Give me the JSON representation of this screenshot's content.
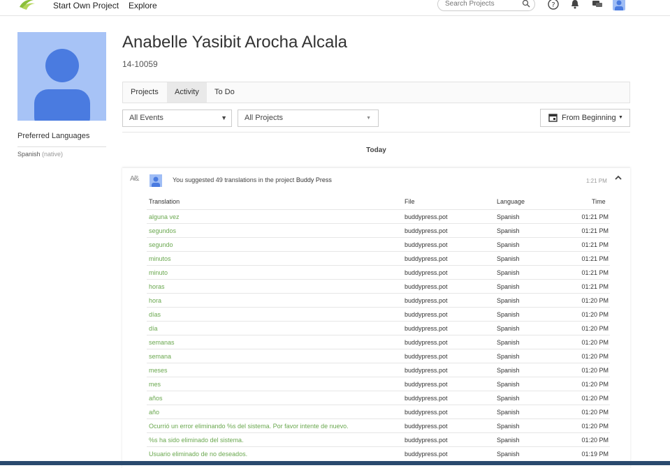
{
  "nav": {
    "start_own_project": "Start Own Project",
    "explore": "Explore",
    "search_placeholder": "Search Projects"
  },
  "profile": {
    "name": "Anabelle Yasibit Arocha Alcala",
    "id": "14-10059",
    "preferred_languages_title": "Preferred Languages",
    "language": "Spanish",
    "language_note": "(native)"
  },
  "tabs": [
    {
      "label": "Projects",
      "active": false
    },
    {
      "label": "Activity",
      "active": true
    },
    {
      "label": "To Do",
      "active": false
    }
  ],
  "filters": {
    "events": "All Events",
    "projects": "All Projects",
    "date": "From Beginning"
  },
  "day_label": "Today",
  "activity": {
    "text_prefix": "You suggested 49 translations in the project",
    "project": "Buddy Press",
    "time": "1:21 PM",
    "columns": {
      "translation": "Translation",
      "file": "File",
      "language": "Language",
      "time": "Time"
    },
    "rows": [
      {
        "translation": "alguna vez",
        "file": "buddypress.pot",
        "language": "Spanish",
        "time": "01:21 PM"
      },
      {
        "translation": "segundos",
        "file": "buddypress.pot",
        "language": "Spanish",
        "time": "01:21 PM"
      },
      {
        "translation": "segundo",
        "file": "buddypress.pot",
        "language": "Spanish",
        "time": "01:21 PM"
      },
      {
        "translation": "minutos",
        "file": "buddypress.pot",
        "language": "Spanish",
        "time": "01:21 PM"
      },
      {
        "translation": "minuto",
        "file": "buddypress.pot",
        "language": "Spanish",
        "time": "01:21 PM"
      },
      {
        "translation": "horas",
        "file": "buddypress.pot",
        "language": "Spanish",
        "time": "01:21 PM"
      },
      {
        "translation": "hora",
        "file": "buddypress.pot",
        "language": "Spanish",
        "time": "01:20 PM"
      },
      {
        "translation": "días",
        "file": "buddypress.pot",
        "language": "Spanish",
        "time": "01:20 PM"
      },
      {
        "translation": "día",
        "file": "buddypress.pot",
        "language": "Spanish",
        "time": "01:20 PM"
      },
      {
        "translation": "semanas",
        "file": "buddypress.pot",
        "language": "Spanish",
        "time": "01:20 PM"
      },
      {
        "translation": "semana",
        "file": "buddypress.pot",
        "language": "Spanish",
        "time": "01:20 PM"
      },
      {
        "translation": "meses",
        "file": "buddypress.pot",
        "language": "Spanish",
        "time": "01:20 PM"
      },
      {
        "translation": "mes",
        "file": "buddypress.pot",
        "language": "Spanish",
        "time": "01:20 PM"
      },
      {
        "translation": "años",
        "file": "buddypress.pot",
        "language": "Spanish",
        "time": "01:20 PM"
      },
      {
        "translation": "año",
        "file": "buddypress.pot",
        "language": "Spanish",
        "time": "01:20 PM"
      },
      {
        "translation": "Ocurrió un error eliminando %s del sistema. Por favor intente de nuevo.",
        "file": "buddypress.pot",
        "language": "Spanish",
        "time": "01:20 PM"
      },
      {
        "translation": "%s ha sido eliminado del sistema.",
        "file": "buddypress.pot",
        "language": "Spanish",
        "time": "01:20 PM"
      },
      {
        "translation": "Usuario eliminado de no deseados.",
        "file": "buddypress.pot",
        "language": "Spanish",
        "time": "01:19 PM"
      }
    ]
  },
  "colors": {
    "translation_link": "#6aa84f",
    "avatar": "#9fbdf5",
    "avatar_figure": "#4a7be0"
  }
}
